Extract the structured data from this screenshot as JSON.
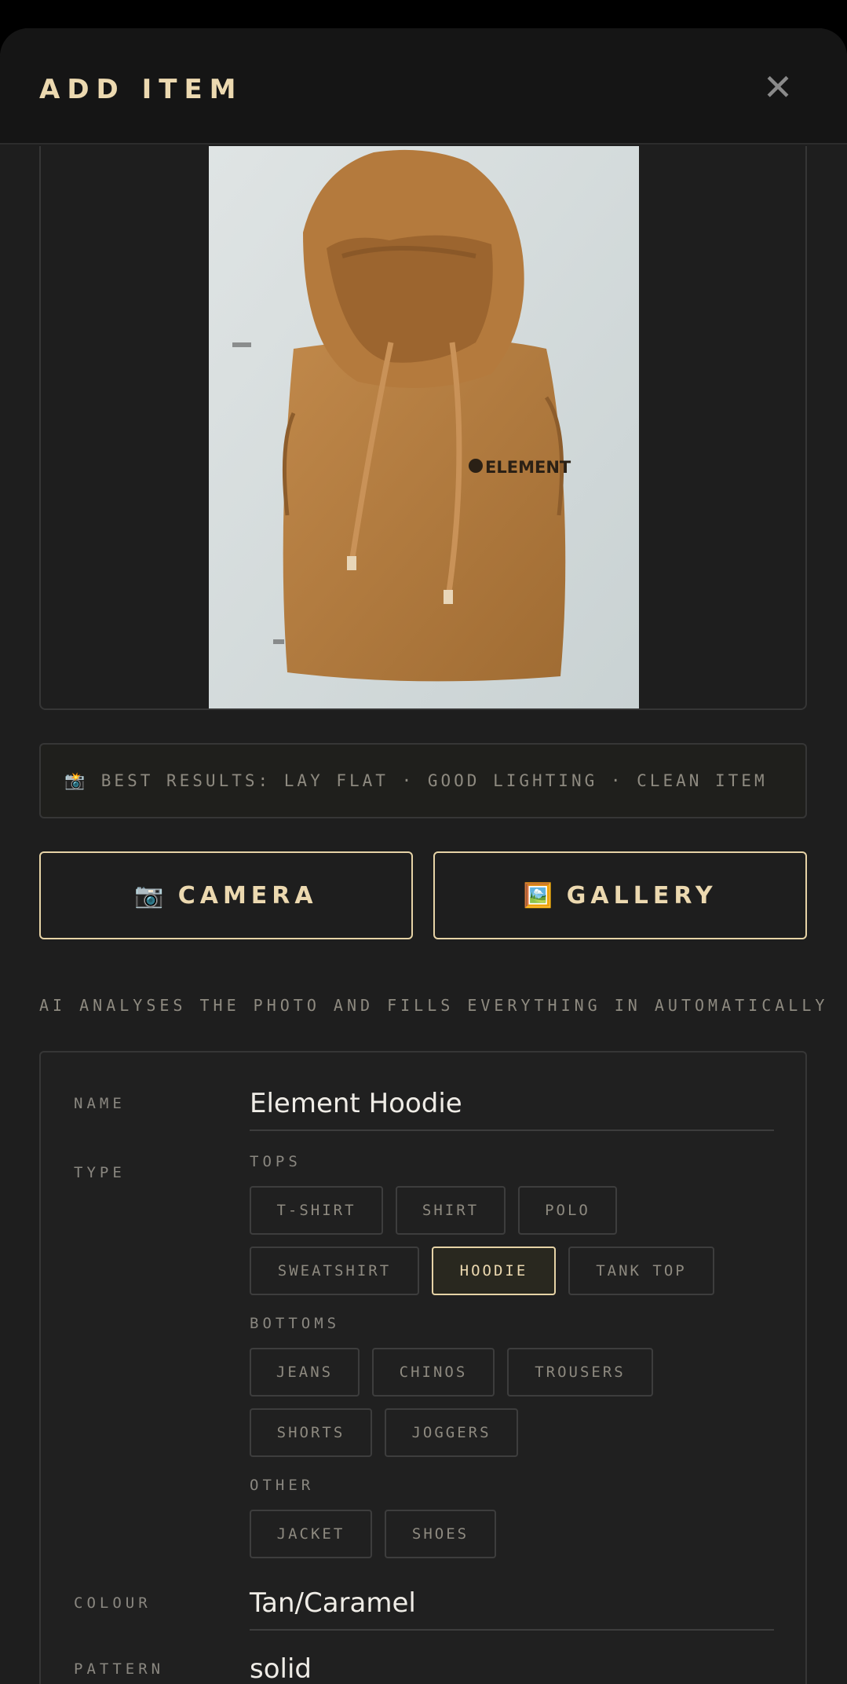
{
  "header": {
    "title": "ADD ITEM",
    "close_glyph": "✕"
  },
  "photo": {
    "alt": "hoodie photo"
  },
  "tip": {
    "text": "📸 BEST RESULTS: LAY FLAT · GOOD LIGHTING · CLEAN ITEM"
  },
  "buttons": {
    "camera": {
      "icon": "📷",
      "label": "CAMERA"
    },
    "gallery": {
      "icon": "🖼️",
      "label": "GALLERY"
    }
  },
  "ai_note": "AI ANALYSES THE PHOTO AND FILLS EVERYTHING IN AUTOMATICALLY",
  "form": {
    "name": {
      "label": "NAME",
      "value": "Element Hoodie"
    },
    "type": {
      "label": "TYPE",
      "selected": "HOODIE",
      "groups": [
        {
          "title": "TOPS",
          "options": [
            "T-SHIRT",
            "SHIRT",
            "POLO",
            "SWEATSHIRT",
            "HOODIE",
            "TANK TOP"
          ]
        },
        {
          "title": "BOTTOMS",
          "options": [
            "JEANS",
            "CHINOS",
            "TROUSERS",
            "SHORTS",
            "JOGGERS"
          ]
        },
        {
          "title": "OTHER",
          "options": [
            "JACKET",
            "SHOES"
          ]
        }
      ]
    },
    "colour": {
      "label": "COLOUR",
      "value": "Tan/Caramel"
    },
    "pattern": {
      "label": "PATTERN",
      "value": "solid"
    }
  },
  "colors": {
    "accent": "#e6d3a6",
    "background": "#1e1e1e",
    "garment": "#b07a3c"
  }
}
